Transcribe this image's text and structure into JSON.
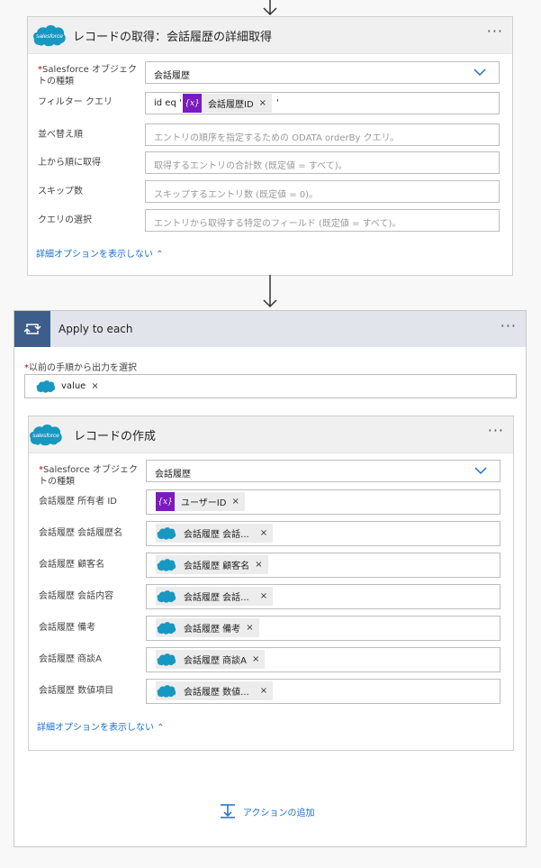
{
  "get_records": {
    "title": "レコードの取得：会話履歴の詳細取得",
    "more": "···",
    "rows": [
      {
        "label": "Salesforce オブジェクトの種類",
        "required": "*",
        "value": "会話履歴"
      },
      {
        "label": "フィルター クエリ",
        "prefix": "id eq '",
        "token": "会話履歴ID",
        "suffix": "'"
      },
      {
        "label": "並べ替え順",
        "placeholder": "エントリの順序を指定するための ODATA orderBy クエリ。"
      },
      {
        "label": "上から順に取得",
        "placeholder": "取得するエントリの合計数 (既定値 = すべて)。"
      },
      {
        "label": "スキップ数",
        "placeholder": "スキップするエントリ数 (既定値 = 0)。"
      },
      {
        "label": "クエリの選択",
        "placeholder": "エントリから取得する特定のフィールド (既定値 = すべて)。"
      }
    ],
    "advanced_link": "詳細オプションを表示しない ⌃"
  },
  "apply_to_each": {
    "title": "Apply to each",
    "more": "···",
    "select_label": "以前の手順から出力を選択",
    "required": "*",
    "token": "value"
  },
  "create_record": {
    "title": "レコードの作成",
    "more": "···",
    "object_label": "Salesforce オブジェクトの種類",
    "required": "*",
    "object_value": "会話履歴",
    "rows": [
      {
        "label": "会話履歴 所有者 ID",
        "token": "ユーザーID",
        "icon": "variable"
      },
      {
        "label": "会話履歴 会話履歴名",
        "token": "会話履歴 会話...",
        "icon": "salesforce"
      },
      {
        "label": "会話履歴 顧客名",
        "token": "会話履歴 顧客名",
        "icon": "salesforce"
      },
      {
        "label": "会話履歴 会話内容",
        "token": "会話履歴 会話...",
        "icon": "salesforce"
      },
      {
        "label": "会話履歴 備考",
        "token": "会話履歴 備考",
        "icon": "salesforce"
      },
      {
        "label": "会話履歴 商談A",
        "token": "会話履歴 商談A",
        "icon": "salesforce"
      },
      {
        "label": "会話履歴 数値項目",
        "token": "会話履歴 数値...",
        "icon": "salesforce"
      }
    ],
    "advanced_link": "詳細オプションを表示しない ⌃"
  },
  "add_action": {
    "label": "アクションの追加"
  },
  "icons": {
    "salesforce_text": "salesforce",
    "variable_text": "{x}",
    "close": "×"
  },
  "colors": {
    "salesforce": "#1798c1",
    "variable": "#7a1bbf",
    "loop": "#3d5d8a",
    "link": "#1a6fd0"
  }
}
